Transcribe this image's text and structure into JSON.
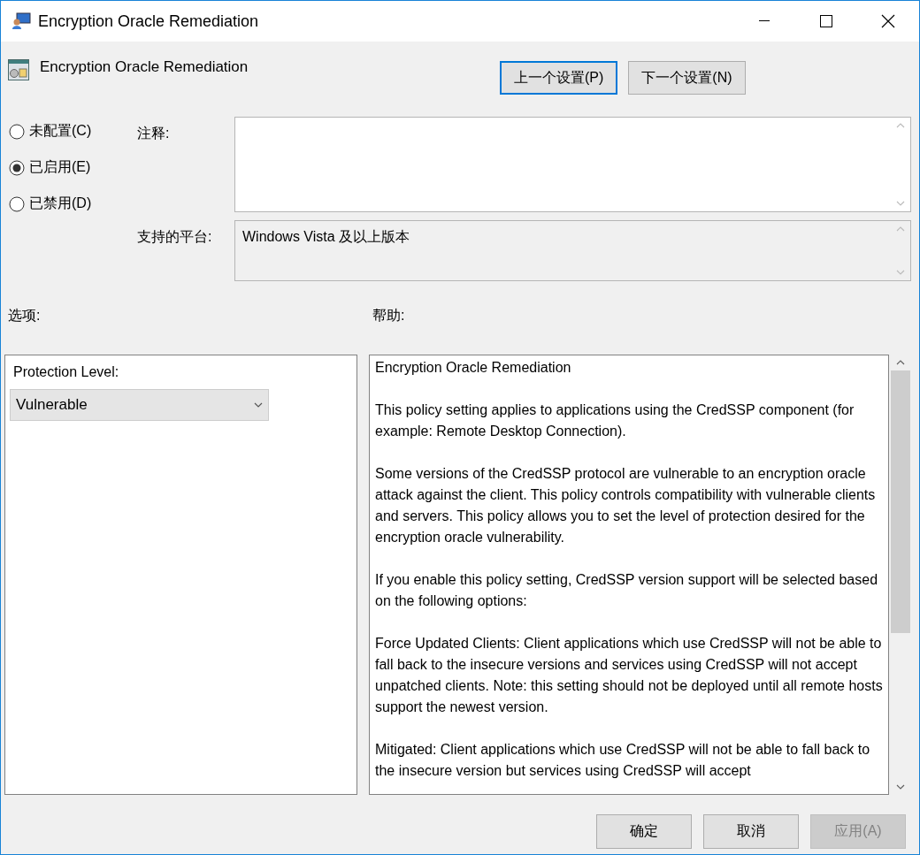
{
  "window": {
    "title": "Encryption Oracle Remediation"
  },
  "policy": {
    "name": "Encryption Oracle Remediation"
  },
  "nav_buttons": [
    {
      "label": "上一个设置(P)",
      "focused": true
    },
    {
      "label": "下一个设置(N)",
      "focused": false
    }
  ],
  "states": [
    {
      "label": "未配置(C)",
      "selected": false
    },
    {
      "label": "已启用(E)",
      "selected": true
    },
    {
      "label": "已禁用(D)",
      "selected": false
    }
  ],
  "comment": {
    "label": "注释:"
  },
  "platform": {
    "label": "支持的平台:",
    "value": "Windows Vista 及以上版本"
  },
  "options": {
    "label": "选项:",
    "fields": [
      {
        "label": "Protection Level:",
        "value": "Vulnerable"
      }
    ]
  },
  "help": {
    "label": "帮助:",
    "paragraphs": [
      "Encryption Oracle Remediation",
      "This policy setting applies to applications using the CredSSP component (for example: Remote Desktop Connection).",
      "Some versions of the CredSSP protocol are vulnerable to an encryption oracle attack against the client.  This policy controls compatibility with vulnerable clients and servers.  This policy allows you to set the level of protection desired for the encryption oracle vulnerability.",
      "If you enable this policy setting, CredSSP version support will be selected based on the following options:",
      "Force Updated Clients: Client applications which use CredSSP will not be able to fall back to the insecure versions and services using CredSSP will not accept unpatched clients. Note: this setting should not be deployed until all remote hosts support the newest version.",
      "Mitigated: Client applications which use CredSSP will not be able to fall back to the insecure version but services using CredSSP will accept"
    ]
  },
  "buttons": [
    {
      "label": "确定",
      "disabled": false
    },
    {
      "label": "取消",
      "disabled": false
    },
    {
      "label": "应用(A)",
      "disabled": true
    }
  ]
}
